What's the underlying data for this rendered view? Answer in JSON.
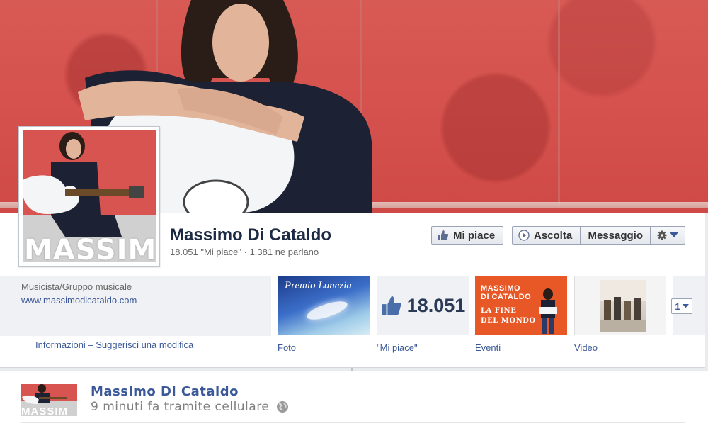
{
  "page": {
    "name": "Massimo Di Cataldo",
    "stats": "18.051 \"Mi piace\" · 1.381 ne parlano",
    "profile_brand_text": "MASSIMO"
  },
  "actions": {
    "like": "Mi piace",
    "listen": "Ascolta",
    "message": "Messaggio"
  },
  "about": {
    "category": "Musicista/Gruppo musicale",
    "website": "www.massimodicataldo.com",
    "links": "Informazioni – Suggerisci una modifica"
  },
  "apps": {
    "foto": {
      "label": "Foto",
      "thumb_title": "Premio Lunezia"
    },
    "likes": {
      "label": "\"Mi piace\"",
      "count": "18.051"
    },
    "eventi": {
      "label": "Eventi",
      "line1": "MASSIMO",
      "line2": "DI CATALDO",
      "line3": "LA FINE",
      "line4": "DEL MONDO"
    },
    "video": {
      "label": "Video"
    },
    "more_count": "1"
  },
  "post": {
    "author": "Massimo Di Cataldo",
    "meta": "9 minuti fa tramite cellulare",
    "avatar_brand": "MASSIM"
  },
  "colors": {
    "link": "#3b5998",
    "cover_red": "#d6534f",
    "eventi_orange": "#e85726"
  },
  "icons": [
    "thumbs-up-icon",
    "play-icon",
    "gear-icon",
    "caret-down-icon",
    "globe-icon"
  ]
}
